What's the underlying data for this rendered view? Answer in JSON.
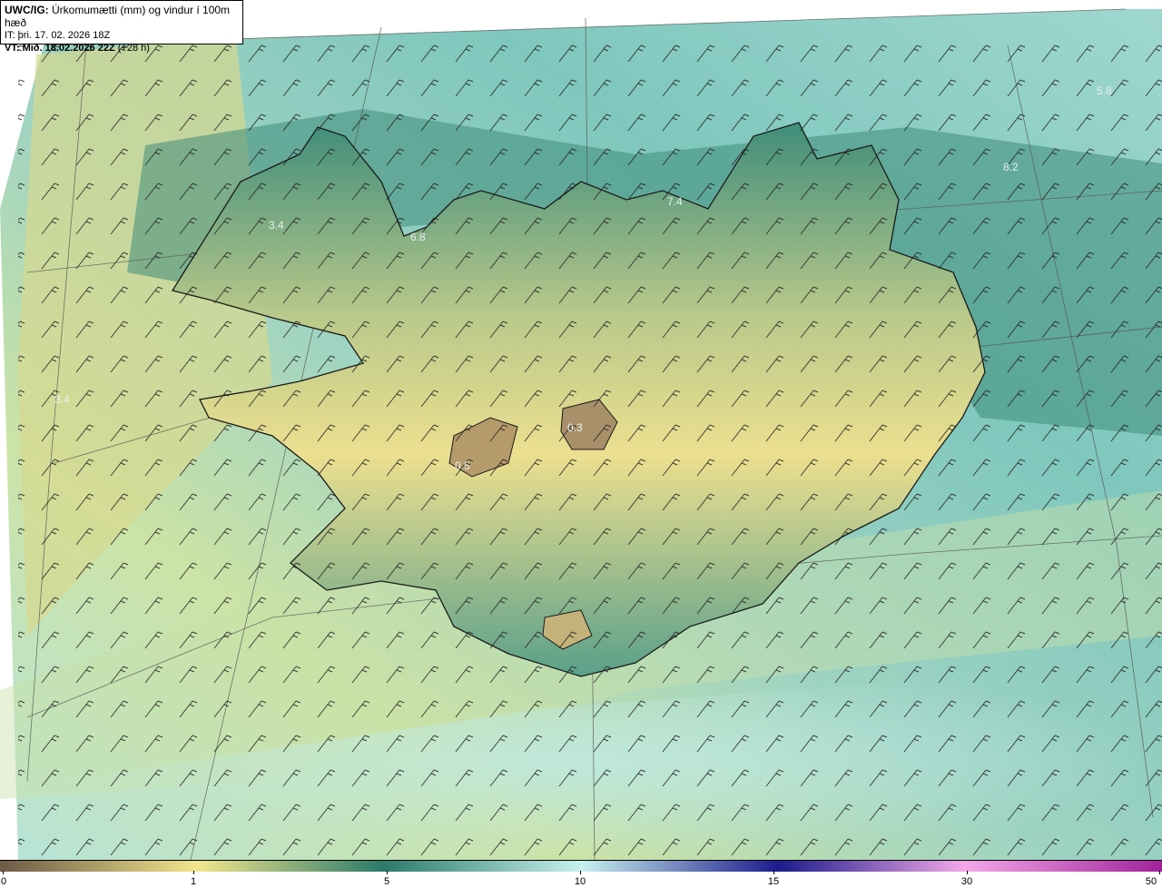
{
  "header": {
    "model_label": "UWC/IG:",
    "title": "Úrkomumætti (mm) og vindur í 100m hæð",
    "init_time": "IT: þri. 17. 02. 2026 18Z",
    "valid_label": "VT:",
    "valid_time": "Mið. 18.02.2026 22Z",
    "lead": "(+28 h)"
  },
  "map_labels": [
    {
      "text": "3.4"
    },
    {
      "text": "6.8"
    },
    {
      "text": "7.4"
    },
    {
      "text": "5.8"
    },
    {
      "text": "8.2"
    },
    {
      "text": "3.4"
    },
    {
      "text": "0.5"
    },
    {
      "text": "0.3"
    }
  ],
  "colorbar": {
    "ticks": [
      "0",
      "1",
      "5",
      "10",
      "15",
      "30",
      "50"
    ],
    "colors": {
      "dry": "#6b5a45",
      "low": "#f2e58c",
      "mid": "#2a7a6a",
      "high": "#c7f0ee",
      "veryhigh": "#1b1b8c",
      "extreme": "#a0229a"
    }
  },
  "colors": {
    "sea_wet": "#9fd7d0",
    "sea_dry": "#d8dc8c",
    "land_dry": "#e8df8e",
    "coast": "#1a1a1a",
    "barb": "#222222"
  }
}
